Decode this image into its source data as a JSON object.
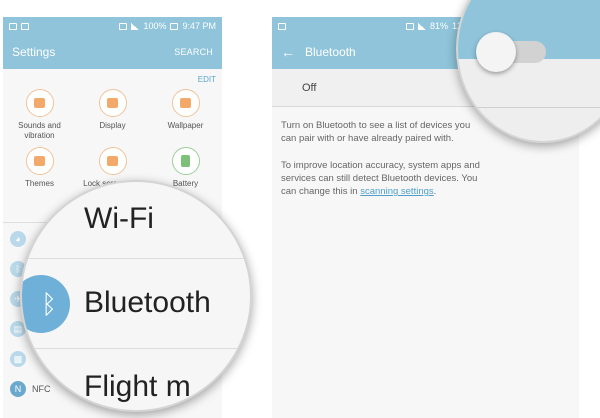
{
  "left_screen": {
    "status_bar": {
      "battery": "100%",
      "time": "9:47 PM"
    },
    "app_bar": {
      "title": "Settings",
      "search_label": "SEARCH"
    },
    "edit_label": "EDIT",
    "quick_settings": [
      {
        "label": "Sounds and vibration",
        "icon": "speaker-icon"
      },
      {
        "label": "Display",
        "icon": "display-icon"
      },
      {
        "label": "Wallpaper",
        "icon": "wallpaper-icon"
      },
      {
        "label": "Themes",
        "icon": "themes-icon"
      },
      {
        "label": "Lock screen and",
        "icon": "lock-icon"
      },
      {
        "label": "Battery",
        "icon": "battery-icon"
      }
    ],
    "list_partial": {
      "nfc": "NFC"
    },
    "magnifier": {
      "wifi": "Wi-Fi",
      "bluetooth": "Bluetooth",
      "flight": "Flight m"
    }
  },
  "right_screen": {
    "status_bar": {
      "battery": "81%",
      "time": "12:"
    },
    "app_bar": {
      "title": "Bluetooth"
    },
    "toggle": {
      "label": "Off",
      "state": "off"
    },
    "description_1": "Turn on Bluetooth to see a list of devices you can pair with or have already paired with.",
    "description_2_text": "To improve location accuracy, system apps and services can still detect Bluetooth devices. You can change this in ",
    "description_2_link": "scanning settings",
    "description_2_end": "."
  },
  "colors": {
    "accent": "#8fc4da",
    "link": "#4f9fc9",
    "bluetooth_icon": "#6fb0d8"
  }
}
